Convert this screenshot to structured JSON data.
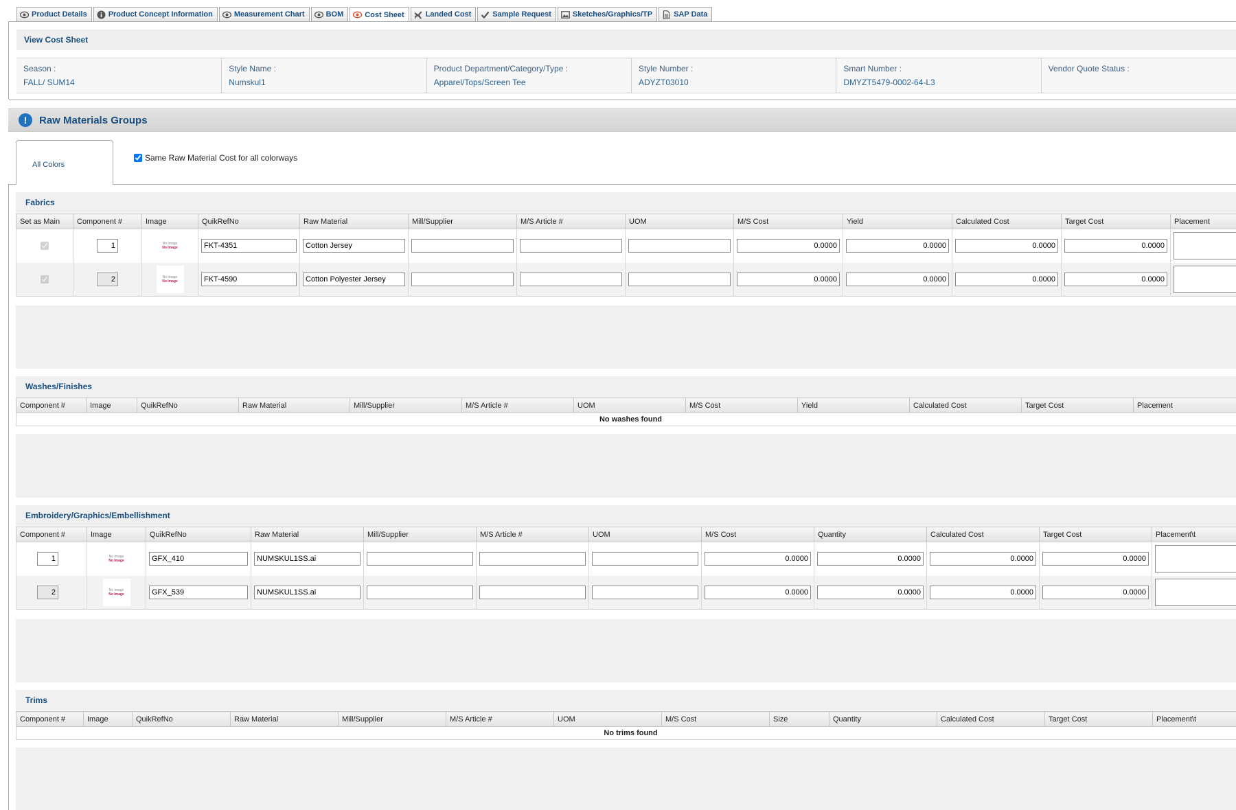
{
  "tabs": [
    {
      "label": "Product Details",
      "icon": "eye-icon"
    },
    {
      "label": "Product Concept Information",
      "icon": "info-icon"
    },
    {
      "label": "Measurement Chart",
      "icon": "eye-icon"
    },
    {
      "label": "BOM",
      "icon": "eye-icon"
    },
    {
      "label": "Cost Sheet",
      "icon": "eye-icon"
    },
    {
      "label": "Landed Cost",
      "icon": "plane-icon"
    },
    {
      "label": "Sample Request",
      "icon": "check-icon"
    },
    {
      "label": "Sketches/Graphics/TP",
      "icon": "image-icon"
    },
    {
      "label": "SAP Data",
      "icon": "document-icon"
    }
  ],
  "active_tab": "Cost Sheet",
  "view_cost_sheet": {
    "title": "View Cost Sheet",
    "fields": [
      {
        "label": "Season :",
        "value": "FALL/ SUM14"
      },
      {
        "label": "Style Name :",
        "value": "Numskul1"
      },
      {
        "label": "Product Department/Category/Type :",
        "value": "Apparel/Tops/Screen Tee"
      },
      {
        "label": "Style Number :",
        "value": "ADYZT03010"
      },
      {
        "label": "Smart Number :",
        "value": "DMYZT5479-0002-64-L3"
      },
      {
        "label": "Vendor Quote Status :",
        "value": ""
      }
    ]
  },
  "raw_materials": {
    "title": "Raw Materials Groups",
    "alert_glyph": "!",
    "color_tab": "All Colors",
    "same_cost_label": "Same Raw Material Cost for all colorways",
    "same_cost_checked": true
  },
  "thumb_text": {
    "line1": "No Image",
    "line2": "No Image"
  },
  "fabrics": {
    "title": "Fabrics",
    "headers": [
      "Set as Main",
      "Component #",
      "Image",
      "QuikRefNo",
      "Raw Material",
      "Mill/Supplier",
      "M/S Article #",
      "UOM",
      "M/S Cost",
      "Yield",
      "Calculated Cost",
      "Target Cost",
      "Placement"
    ],
    "rows": [
      {
        "component": "1",
        "quikref": "FKT-4351",
        "raw_material": "Cotton Jersey",
        "ms_cost": "0.0000",
        "yield": "0.0000",
        "calc_cost": "0.0000",
        "target_cost": "0.0000"
      },
      {
        "component": "2",
        "quikref": "FKT-4590",
        "raw_material": "Cotton Polyester Jersey",
        "ms_cost": "0.0000",
        "yield": "0.0000",
        "calc_cost": "0.0000",
        "target_cost": "0.0000"
      }
    ]
  },
  "washes": {
    "title": "Washes/Finishes",
    "headers": [
      "Component #",
      "Image",
      "QuikRefNo",
      "Raw Material",
      "Mill/Supplier",
      "M/S Article #",
      "UOM",
      "M/S Cost",
      "Yield",
      "Calculated Cost",
      "Target Cost",
      "Placement"
    ],
    "empty": "No washes found"
  },
  "embroidery": {
    "title": "Embroidery/Graphics/Embellishment",
    "headers": [
      "Component #",
      "Image",
      "QuikRefNo",
      "Raw Material",
      "Mill/Supplier",
      "M/S Article #",
      "UOM",
      "M/S Cost",
      "Quantity",
      "Calculated Cost",
      "Target Cost",
      "Placement\\t"
    ],
    "rows": [
      {
        "component": "1",
        "quikref": "GFX_410",
        "raw_material": "NUMSKUL1SS.ai",
        "ms_cost": "0.0000",
        "quantity": "0.0000",
        "calc_cost": "0.0000",
        "target_cost": "0.0000"
      },
      {
        "component": "2",
        "quikref": "GFX_539",
        "raw_material": "NUMSKUL1SS.ai",
        "ms_cost": "0.0000",
        "quantity": "0.0000",
        "calc_cost": "0.0000",
        "target_cost": "0.0000"
      }
    ]
  },
  "trims": {
    "title": "Trims",
    "headers": [
      "Component #",
      "Image",
      "QuikRefNo",
      "Raw Material",
      "Mill/Supplier",
      "M/S Article #",
      "UOM",
      "M/S Cost",
      "Size",
      "Quantity",
      "Calculated Cost",
      "Target Cost",
      "Placement\\t"
    ],
    "empty": "No trims found"
  }
}
